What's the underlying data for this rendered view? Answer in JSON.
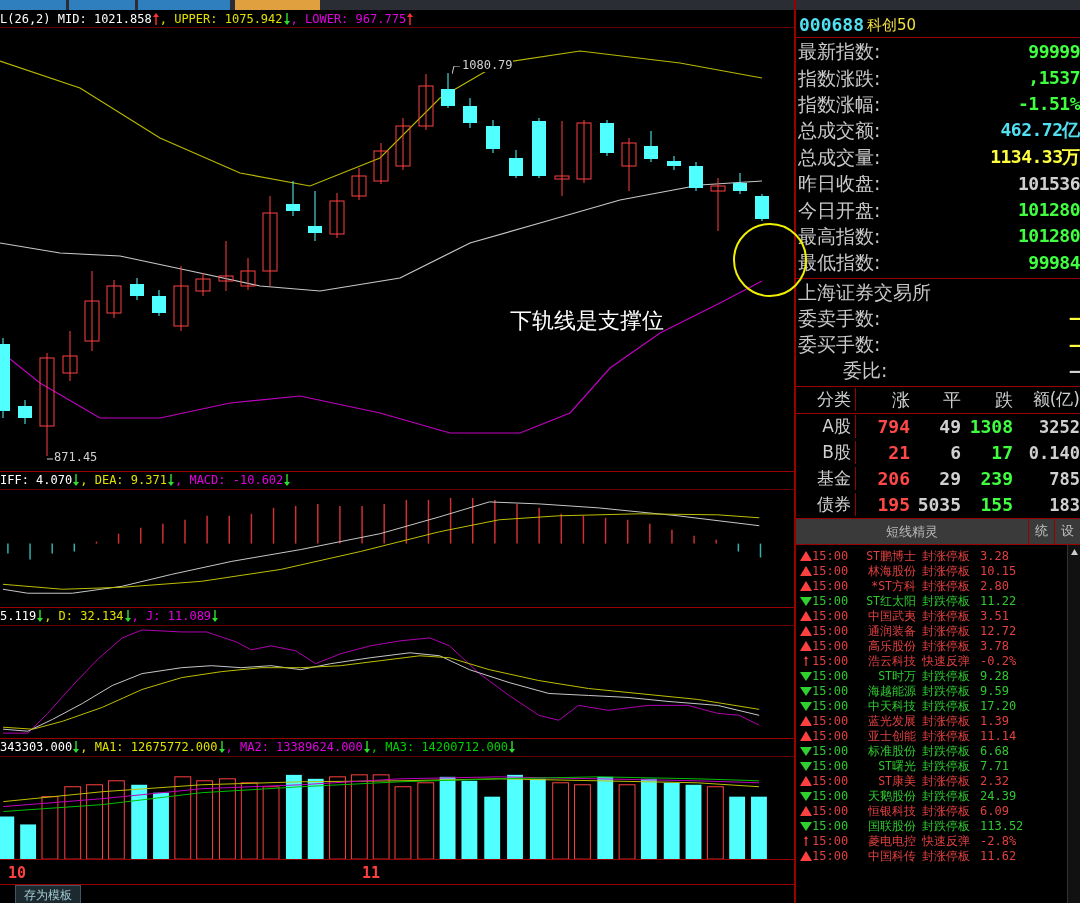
{
  "tabs": [
    {
      "selected": false
    },
    {
      "selected": false
    },
    {
      "selected": false
    },
    {
      "selected": true
    }
  ],
  "main_legend": [
    {
      "text": "L(26,2) MID: 1021.858",
      "rising": true
    },
    {
      "text": ", UPPER: 1075.942",
      "rising": false
    },
    {
      "text": ", LOWER: 967.775",
      "rising": true
    }
  ],
  "main_chart": {
    "high_label": "1080.79",
    "low_label": "871.45",
    "annotation": "下轨线是支撑位"
  },
  "macd_legend": [
    {
      "text": "IFF: 4.070",
      "rising": false
    },
    {
      "text": ", DEA: 9.371",
      "rising": false
    },
    {
      "text": ", MACD: -10.602",
      "rising": false
    }
  ],
  "kdj_legend": [
    {
      "text": "5.119",
      "rising": false
    },
    {
      "text": ", D: 32.134",
      "rising": false
    },
    {
      "text": ", J: 11.089",
      "rising": false
    }
  ],
  "vol_legend": [
    {
      "text": "343303.000",
      "rising": false
    },
    {
      "text": ", MA1: 12675772.000",
      "rising": false
    },
    {
      "text": ", MA2: 13389624.000",
      "rising": false
    },
    {
      "text": ", MA3: 14200712.000",
      "rising": false
    }
  ],
  "x_axis": [
    "10",
    "11"
  ],
  "bottom_bar": {
    "button": "存为模板"
  },
  "quote": {
    "code": "000688",
    "name": "科创50",
    "rows": [
      {
        "label": "最新指数:",
        "value": "99999",
        "color": "#40ff40"
      },
      {
        "label": "指数涨跌:",
        "value": ",1537",
        "color": "#40ff40"
      },
      {
        "label": "指数涨幅:",
        "value": "-1.51%",
        "color": "#40ff40"
      },
      {
        "label": "总成交额:",
        "value": "462.72亿",
        "color": "#50e0f0"
      },
      {
        "label": "总成交量:",
        "value": "1134.33万",
        "color": "#ffff40"
      },
      {
        "label": "昨日收盘:",
        "value": "101536",
        "color": "#d0d0d0"
      },
      {
        "label": "今日开盘:",
        "value": "101280",
        "color": "#40ff40"
      },
      {
        "label": "最高指数:",
        "value": "101280",
        "color": "#40ff40"
      },
      {
        "label": "最低指数:",
        "value": "99984",
        "color": "#40ff40"
      }
    ],
    "exchange": "上海证券交易所",
    "order_rows": [
      {
        "label": "委卖手数:",
        "value": "—",
        "color": "#ffff40"
      },
      {
        "label": "委买手数:",
        "value": "—",
        "color": "#ffff40"
      },
      {
        "label": "委比:",
        "value": "—",
        "color": "#d0d0d0"
      }
    ]
  },
  "market_table": {
    "columns": [
      "分类",
      "涨",
      "平",
      "跌",
      "额(亿)"
    ],
    "rows": [
      [
        "A股",
        "794",
        "49",
        "1308",
        "3252"
      ],
      [
        "B股",
        "21",
        "6",
        "17",
        "0.140"
      ],
      [
        "基金",
        "206",
        "29",
        "239",
        "785"
      ],
      [
        "债券",
        "195",
        "5035",
        "155",
        "183"
      ]
    ]
  },
  "alerts": {
    "title": "短线精灵",
    "buttons": [
      "统",
      "设"
    ],
    "rows": [
      {
        "kind": "limit-up",
        "time": "15:00",
        "name": "ST鹏博士",
        "event": "封涨停板",
        "value": "3.28"
      },
      {
        "kind": "limit-up",
        "time": "15:00",
        "name": "林海股份",
        "event": "封涨停板",
        "value": "10.15"
      },
      {
        "kind": "limit-up",
        "time": "15:00",
        "name": "*ST方科",
        "event": "封涨停板",
        "value": "2.80"
      },
      {
        "kind": "limit-down",
        "time": "15:00",
        "name": "ST红太阳",
        "event": "封跌停板",
        "value": "11.22"
      },
      {
        "kind": "limit-up",
        "time": "15:00",
        "name": "中国武夷",
        "event": "封涨停板",
        "value": "3.51"
      },
      {
        "kind": "limit-up",
        "time": "15:00",
        "name": "通润装备",
        "event": "封涨停板",
        "value": "12.72"
      },
      {
        "kind": "limit-up",
        "time": "15:00",
        "name": "高乐股份",
        "event": "封涨停板",
        "value": "3.78"
      },
      {
        "kind": "rebound",
        "time": "15:00",
        "name": "浩云科技",
        "event": "快速反弹",
        "value": "-0.2%"
      },
      {
        "kind": "limit-down",
        "time": "15:00",
        "name": "ST时万",
        "event": "封跌停板",
        "value": "9.28"
      },
      {
        "kind": "limit-down",
        "time": "15:00",
        "name": "海越能源",
        "event": "封跌停板",
        "value": "9.59"
      },
      {
        "kind": "limit-down",
        "time": "15:00",
        "name": "中天科技",
        "event": "封跌停板",
        "value": "17.20"
      },
      {
        "kind": "limit-up",
        "time": "15:00",
        "name": "蓝光发展",
        "event": "封涨停板",
        "value": "1.39"
      },
      {
        "kind": "limit-up",
        "time": "15:00",
        "name": "亚士创能",
        "event": "封涨停板",
        "value": "11.14"
      },
      {
        "kind": "limit-down",
        "time": "15:00",
        "name": "标准股份",
        "event": "封跌停板",
        "value": "6.68"
      },
      {
        "kind": "limit-down",
        "time": "15:00",
        "name": "ST曙光",
        "event": "封跌停板",
        "value": "7.71"
      },
      {
        "kind": "limit-up",
        "time": "15:00",
        "name": "ST康美",
        "event": "封涨停板",
        "value": "2.32"
      },
      {
        "kind": "limit-down",
        "time": "15:00",
        "name": "天鹅股份",
        "event": "封跌停板",
        "value": "24.39"
      },
      {
        "kind": "limit-up",
        "time": "15:00",
        "name": "恒银科技",
        "event": "封涨停板",
        "value": "6.09"
      },
      {
        "kind": "limit-down",
        "time": "15:00",
        "name": "国联股份",
        "event": "封跌停板",
        "value": "113.52"
      },
      {
        "kind": "rebound",
        "time": "15:00",
        "name": "菱电电控",
        "event": "快速反弹",
        "value": "-2.8%"
      },
      {
        "kind": "limit-up",
        "time": "15:00",
        "name": "中国科传",
        "event": "封涨停板",
        "value": "11.62"
      }
    ]
  }
}
